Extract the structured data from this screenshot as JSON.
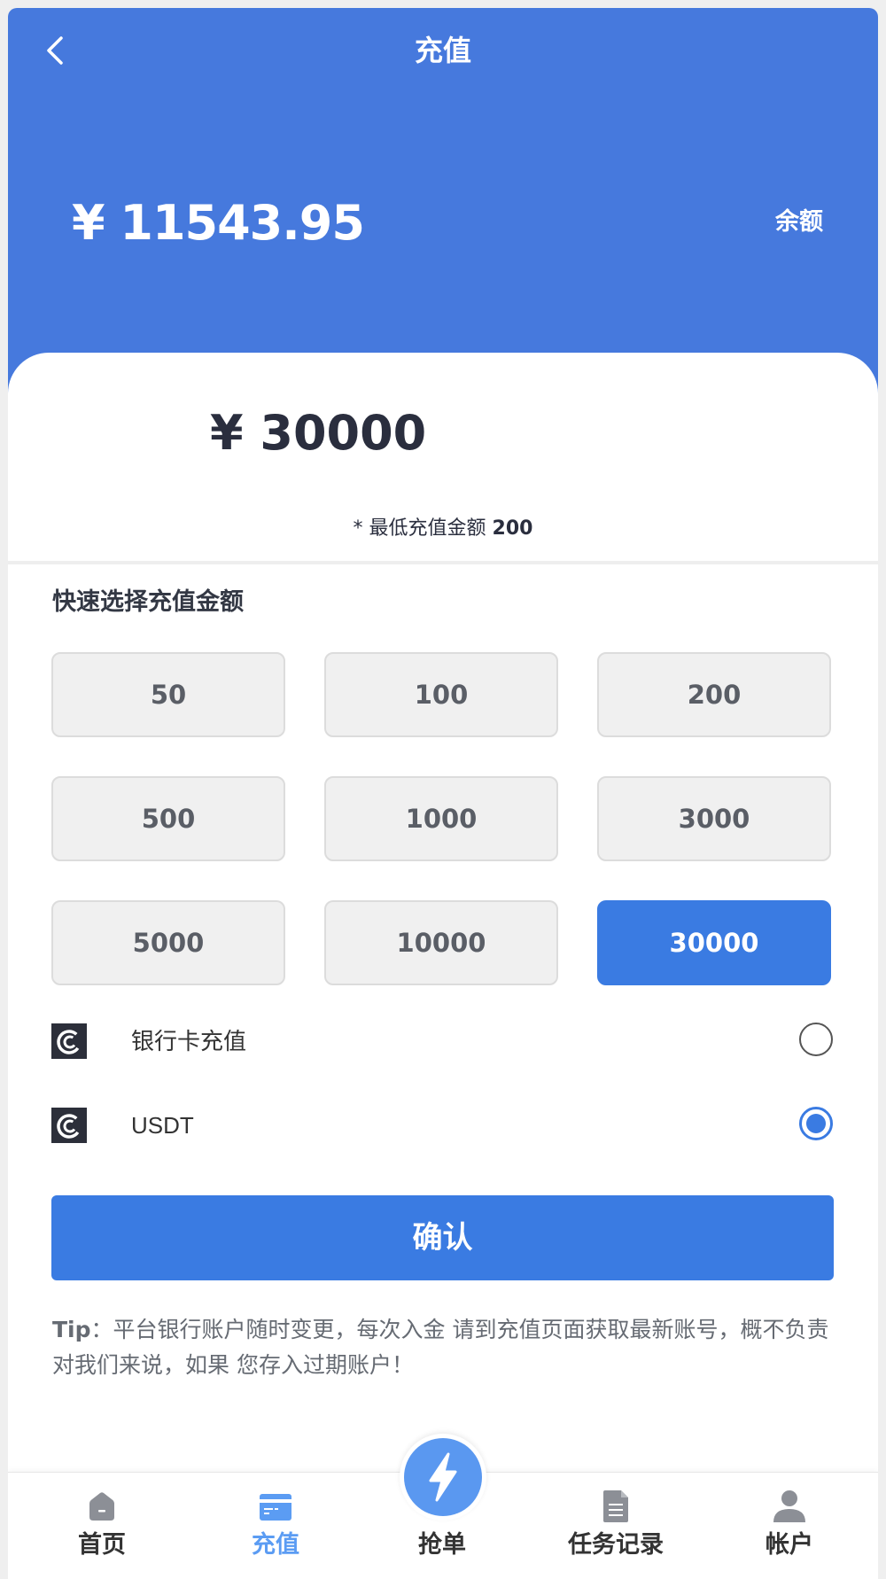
{
  "header": {
    "title": "充值",
    "balance": "¥ 11543.95",
    "balance_label": "余额"
  },
  "recharge": {
    "amount": "¥ 30000",
    "min_note_prefix": "* 最低充值金额 ",
    "min_note_value": "200"
  },
  "quick_select": {
    "title": "快速选择充值金额",
    "amounts": [
      "50",
      "100",
      "200",
      "500",
      "1000",
      "3000",
      "5000",
      "10000",
      "30000"
    ],
    "selected": "30000"
  },
  "payment_methods": [
    {
      "label": "银行卡充值",
      "checked": false
    },
    {
      "label": "USDT",
      "checked": true
    }
  ],
  "confirm_label": "确认",
  "tip": {
    "prefix": "Tip",
    "text": "：平台银行账户随时变更，每次入金 请到充值页面获取最新账号，概不负责 对我们来说，如果 您存入过期账户！"
  },
  "tabbar": {
    "items": [
      {
        "label": "首页",
        "icon": "home-icon",
        "active": false
      },
      {
        "label": "充值",
        "icon": "card-icon",
        "active": true
      },
      {
        "label": "抢单",
        "icon": "lightning-icon",
        "active": false
      },
      {
        "label": "任务记录",
        "icon": "document-icon",
        "active": false
      },
      {
        "label": "帐户",
        "icon": "user-icon",
        "active": false
      }
    ]
  },
  "colors": {
    "header_blue": "#4679dd",
    "accent_blue": "#3a7be2",
    "tab_active": "#5b9cf3"
  }
}
